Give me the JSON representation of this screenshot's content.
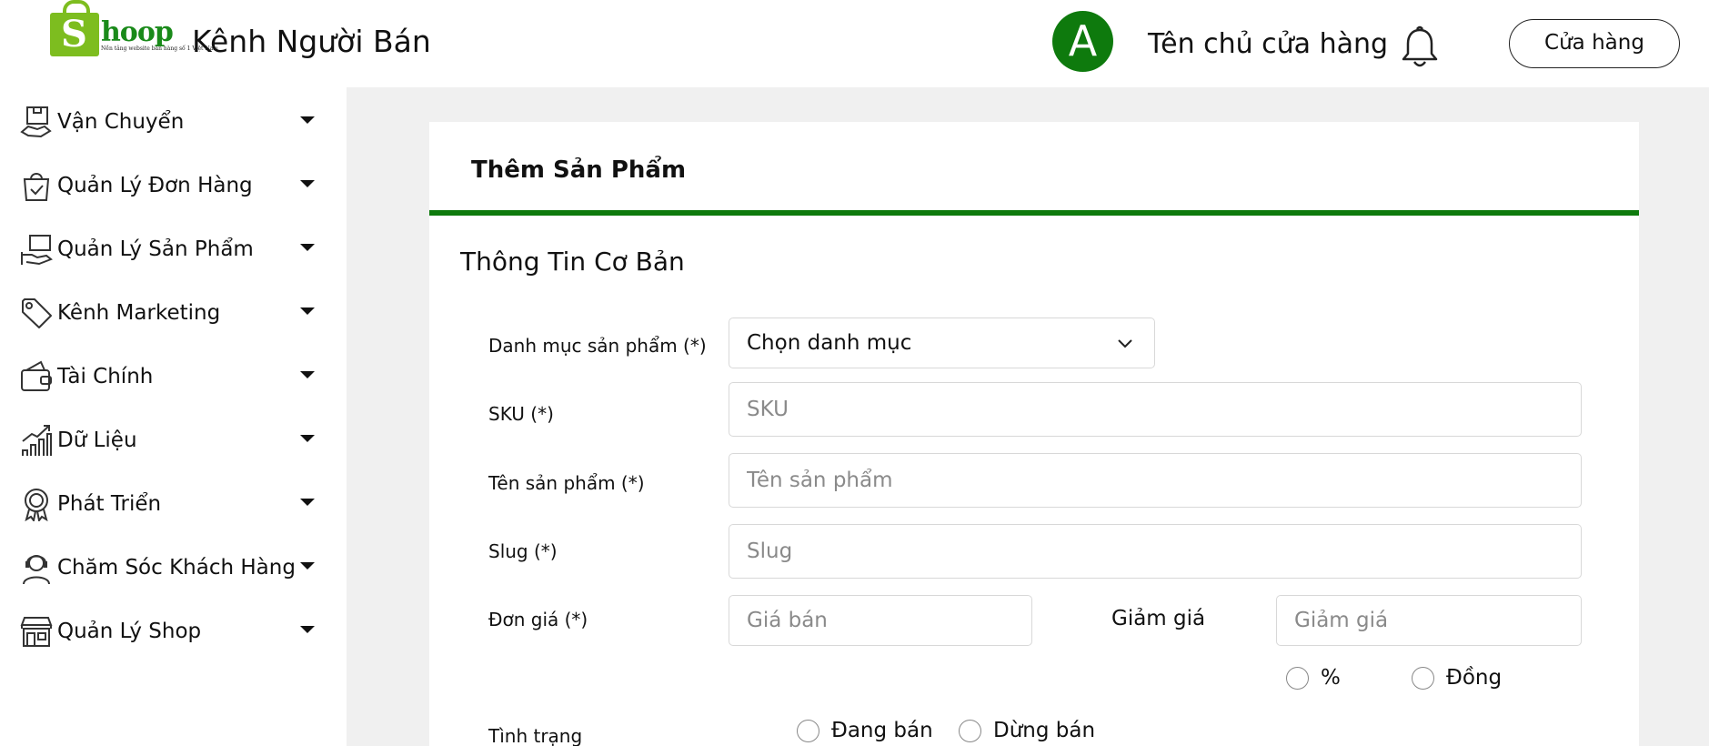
{
  "header": {
    "logo_letter": "S",
    "logo_word": "hoop",
    "logo_tagline": "Nền tảng website bán hàng số 1 Việt Nam",
    "brand_title": "Kênh Người Bán",
    "avatar_initial": "A",
    "shop_owner": "Tên chủ cửa hàng",
    "store_button": "Cửa hàng"
  },
  "sidebar": {
    "items": [
      {
        "label": "Vận Chuyển",
        "icon": "delivery-box-icon"
      },
      {
        "label": "Quản Lý Đơn Hàng",
        "icon": "shopping-bag-icon"
      },
      {
        "label": "Quản Lý Sản Phẩm",
        "icon": "product-hand-icon"
      },
      {
        "label": "Kênh Marketing",
        "icon": "price-tag-icon"
      },
      {
        "label": "Tài Chính",
        "icon": "wallet-icon"
      },
      {
        "label": "Dữ Liệu",
        "icon": "growth-chart-icon"
      },
      {
        "label": "Phát Triển",
        "icon": "award-badge-icon"
      },
      {
        "label": "Chăm Sóc Khách Hàng",
        "icon": "customer-support-icon"
      },
      {
        "label": "Quản Lý Shop",
        "icon": "storefront-icon"
      }
    ]
  },
  "form": {
    "title": "Thêm Sản Phẩm",
    "section_title": "Thông Tin Cơ Bản",
    "category_label": "Danh mục sản phẩm (*)",
    "category_value": "Chọn danh mục",
    "sku_label": "SKU (*)",
    "sku_placeholder": "SKU",
    "name_label": "Tên sản phẩm (*)",
    "name_placeholder": "Tên sản phẩm",
    "slug_label": "Slug (*)",
    "slug_placeholder": "Slug",
    "price_label": "Đơn giá (*)",
    "price_placeholder": "Giá bán",
    "discount_label": "Giảm giá",
    "discount_placeholder": "Giảm giá",
    "discount_unit_percent": "%",
    "discount_unit_currency": "Đồng",
    "status_label": "Tình trạng",
    "status_selling": "Đang bán",
    "status_stopped": "Dừng bán"
  },
  "colors": {
    "brand_green": "#0e7a0d",
    "logo_green": "#7dbd1f",
    "main_background": "#f0f0f0"
  }
}
